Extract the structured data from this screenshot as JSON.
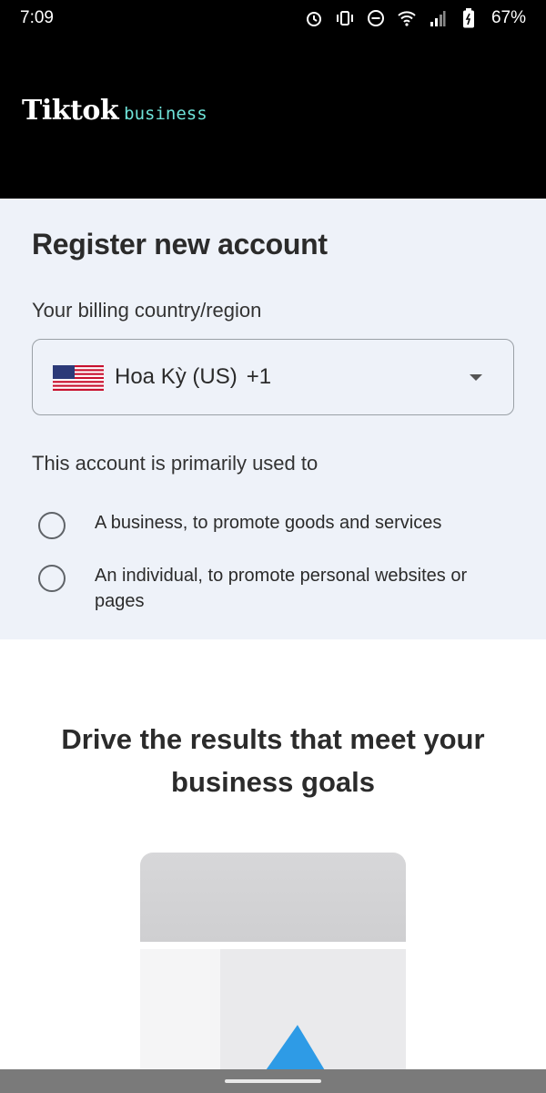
{
  "status_bar": {
    "time": "7:09",
    "battery": "67%",
    "icons": [
      "alarm-icon",
      "vibrate-icon",
      "do-not-disturb-icon",
      "wifi-icon",
      "signal-icon",
      "battery-icon"
    ]
  },
  "header": {
    "brand_main": "Tiktok",
    "brand_sub": "business",
    "brand_sub_color": "#6fe3d9"
  },
  "register": {
    "title": "Register new account",
    "country_label": "Your billing country/region",
    "country_select": {
      "selected_country": "Hoa Kỳ (US)",
      "dial_code": "+1",
      "flag": "us-flag-icon"
    },
    "purpose_label": "This account is primarily used to",
    "options": [
      {
        "label": "A business, to promote goods and services",
        "selected": false
      },
      {
        "label": "An individual, to promote personal websites or pages",
        "selected": false
      }
    ]
  },
  "promo": {
    "title": "Drive the results that meet your business goals"
  },
  "colors": {
    "header_bg": "#000000",
    "panel_bg": "#eef2f9",
    "accent_play": "#2e9be6"
  }
}
